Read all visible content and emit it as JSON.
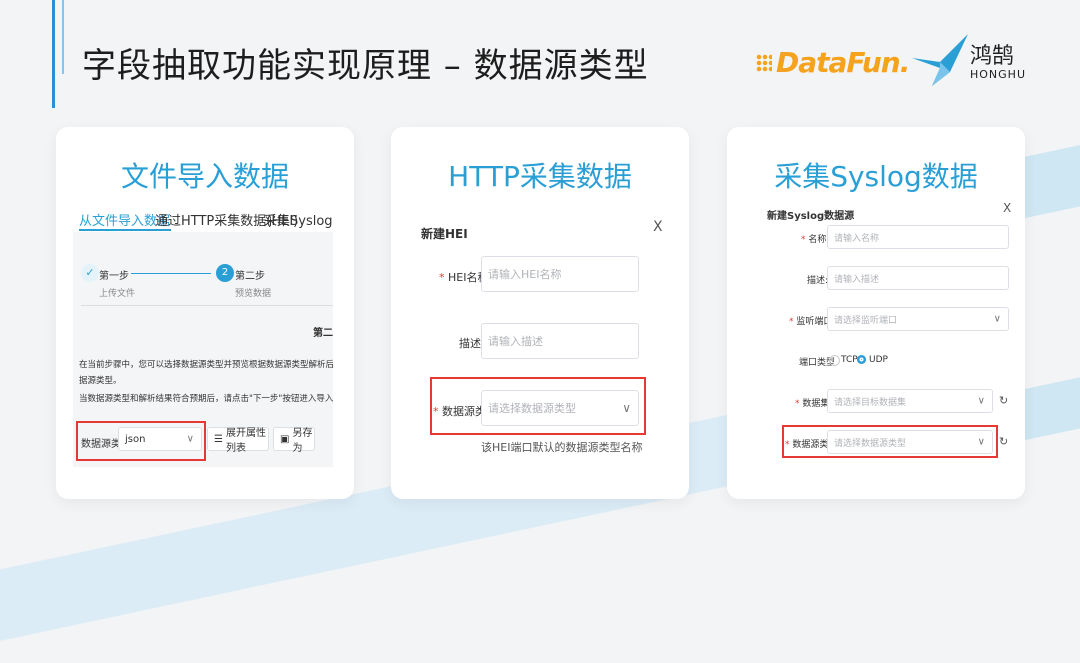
{
  "title": "字段抽取功能实现原理 – 数据源类型",
  "logos": {
    "datafun": "DataFun.",
    "honghu_cn": "鸿鹄",
    "honghu_en": "HONGHU"
  },
  "colors": {
    "accent": "#2a9fd6",
    "highlight": "#e53935"
  },
  "card1": {
    "title": "文件导入数据",
    "tabs": [
      "从文件导入数据",
      "通过HTTP采集数据(HEI)",
      "采集Syslog数据"
    ],
    "steps": [
      {
        "num": "✓",
        "label": "第一步",
        "sub": "上传文件"
      },
      {
        "num": "2",
        "label": "第二步",
        "sub": "预览数据"
      }
    ],
    "step_header": "第二步",
    "para1": "在当前步骤中，您可以选择数据源类型并预览根据数据源类型解析后的数据内容。您可以通过",
    "para1b": "据源类型。",
    "para2": "当数据源类型和解析结果符合预期后，请点击\"下一步\"按钮进入导入数据页面。",
    "field_label": "数据源类型:",
    "field_value": "json",
    "btn_expand": "展开属性列表",
    "btn_save": "另存为"
  },
  "card2": {
    "title": "HTTP采集数据",
    "dialog_title": "新建HEI",
    "close": "X",
    "name_label": "HEI名称:",
    "name_placeholder": "请输入HEI名称",
    "desc_label": "描述:",
    "desc_placeholder": "请输入描述",
    "type_label": "数据源类型:",
    "type_placeholder": "请选择数据源类型",
    "hint": "该HEI端口默认的数据源类型名称"
  },
  "card3": {
    "title": "采集Syslog数据",
    "dialog_title": "新建Syslog数据源",
    "close": "X",
    "name_label": "名称:",
    "name_placeholder": "请输入名称",
    "desc_label": "描述:",
    "desc_placeholder": "请输入描述",
    "port_label": "监听端口:",
    "port_placeholder": "请选择监听端口",
    "ptype_label": "端口类型",
    "tcp": "TCP",
    "udp": "UDP",
    "dataset_label": "数据集:",
    "dataset_placeholder": "请选择目标数据集",
    "type_label": "数据源类型:",
    "type_placeholder": "请选择数据源类型"
  }
}
